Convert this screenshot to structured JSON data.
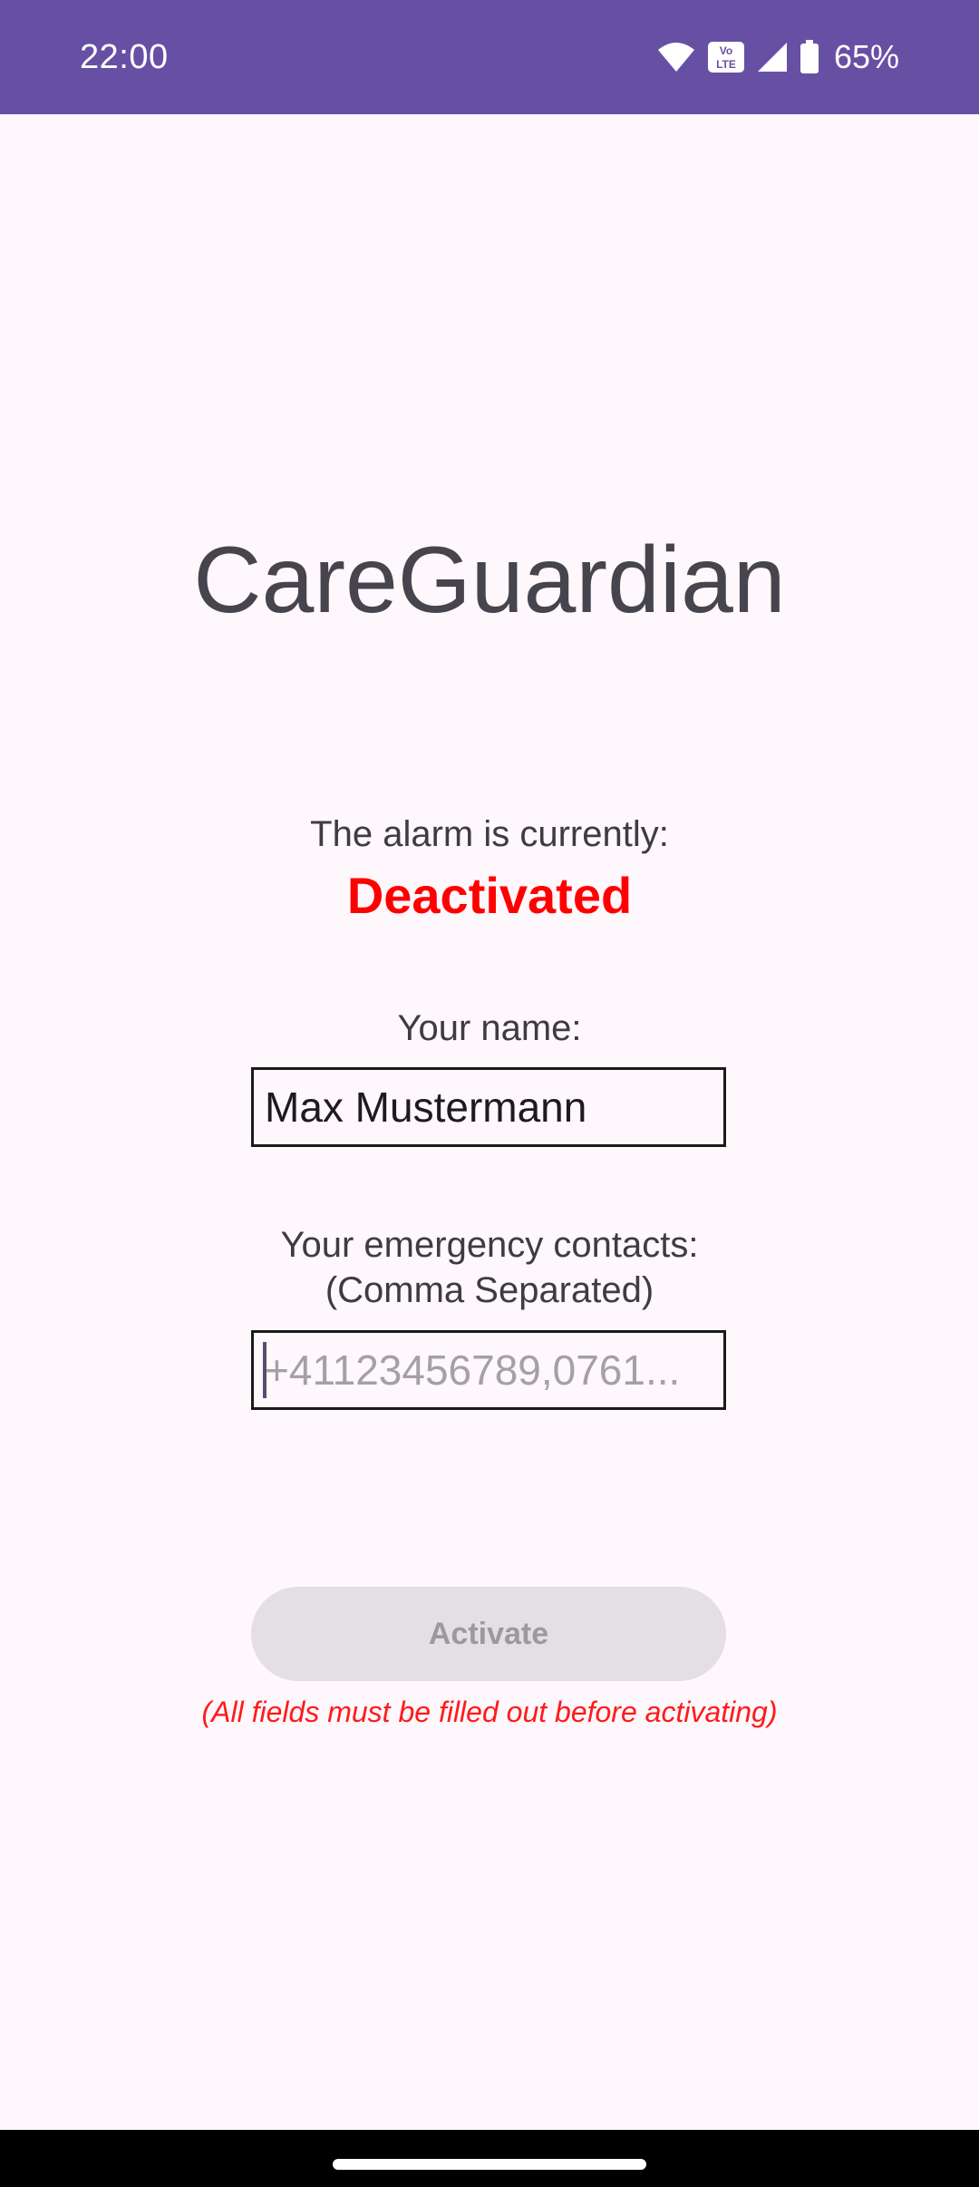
{
  "status_bar": {
    "time": "22:00",
    "battery_percent": "65%",
    "volte_text": "Vo LTE",
    "icons": [
      "wifi-icon",
      "volte-icon",
      "cell-signal-icon",
      "battery-icon"
    ],
    "background_color": "#6750a4"
  },
  "app": {
    "title": "CareGuardian"
  },
  "alarm": {
    "label": "The alarm is currently:",
    "status": "Deactivated",
    "status_color": "#ff0000"
  },
  "name_field": {
    "label": "Your name:",
    "value": "Max Mustermann"
  },
  "contacts_field": {
    "label_line1": "Your emergency contacts:",
    "label_line2": "(Comma Separated)",
    "value": "",
    "placeholder": "+41123456789,0761..."
  },
  "activate_button": {
    "label": "Activate",
    "enabled": false
  },
  "hint": {
    "text": "(All fields must be filled out before activating)",
    "color": "#ff1a1a"
  }
}
